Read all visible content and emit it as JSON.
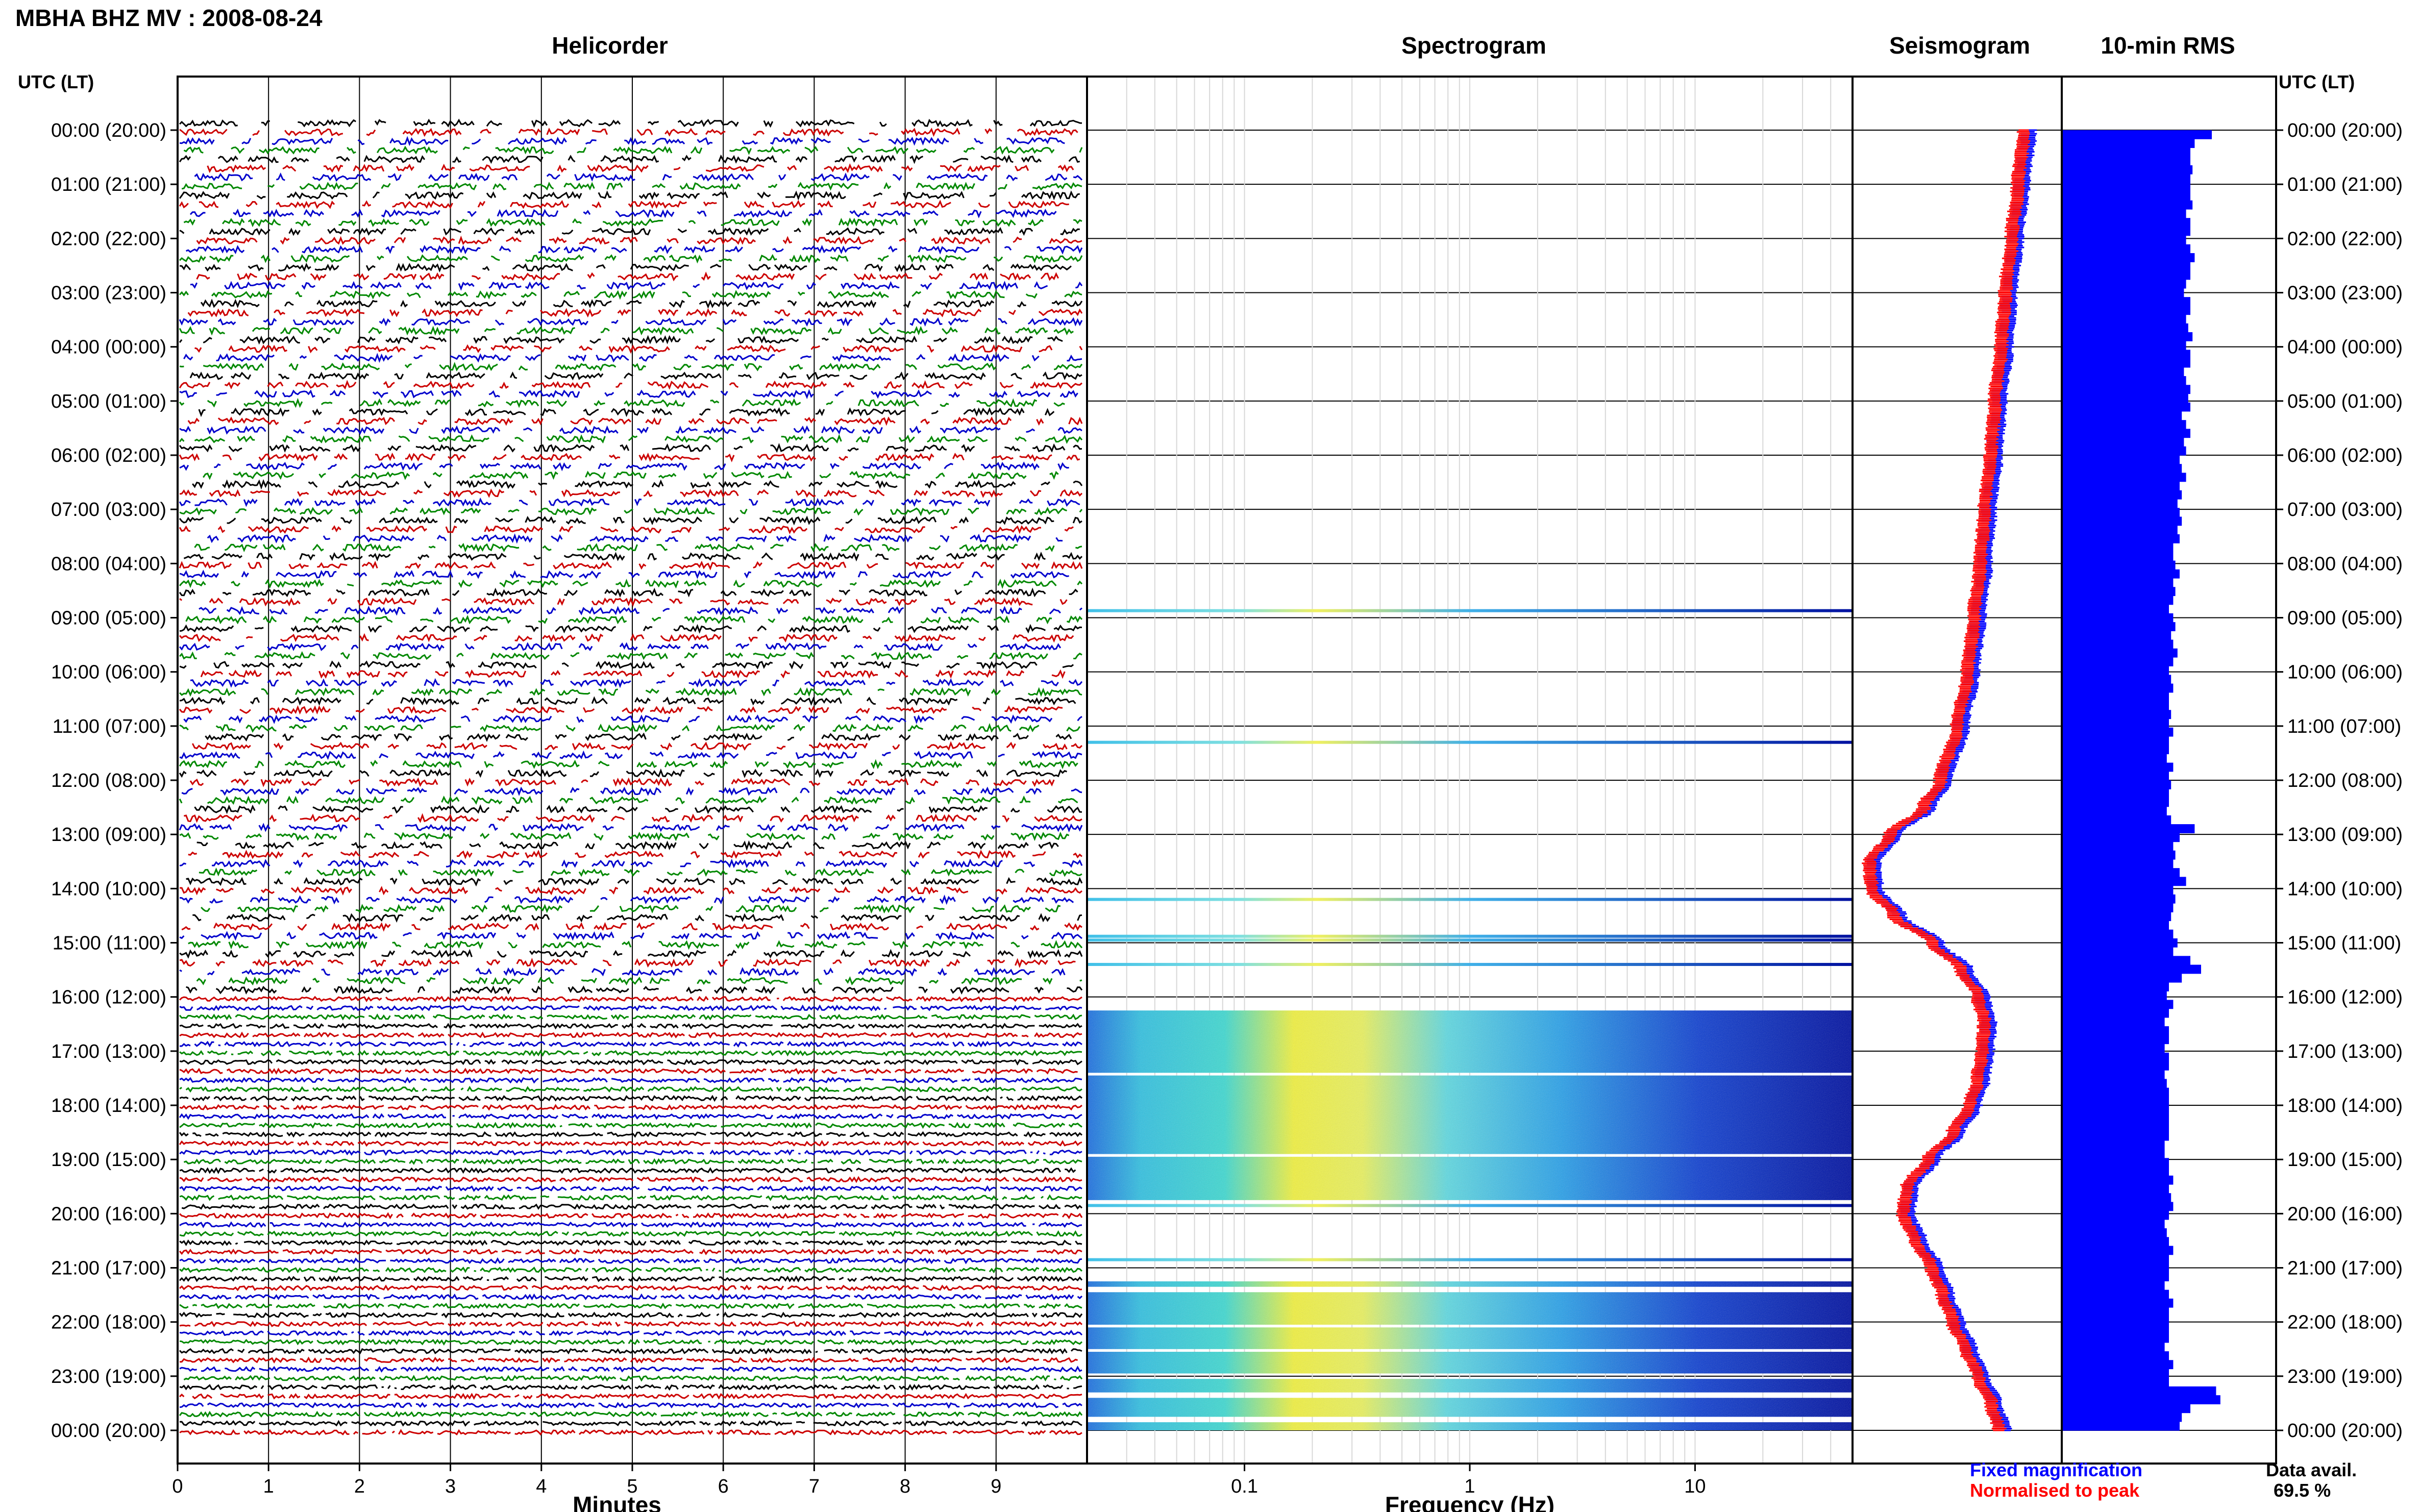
{
  "title": "MBHA BHZ MV : 2008-08-24",
  "panels": {
    "helicorder": "Helicorder",
    "spectrogram": "Spectrogram",
    "seismogram": "Seismogram",
    "rms": "10-min RMS"
  },
  "utc_header_left": "UTC (LT)",
  "utc_header_right": "UTC (LT)",
  "hour_labels": [
    "00:00 (20:00)",
    "01:00 (21:00)",
    "02:00 (22:00)",
    "03:00 (23:00)",
    "04:00 (00:00)",
    "05:00 (01:00)",
    "06:00 (02:00)",
    "07:00 (03:00)",
    "08:00 (04:00)",
    "09:00 (05:00)",
    "10:00 (06:00)",
    "11:00 (07:00)",
    "12:00 (08:00)",
    "13:00 (09:00)",
    "14:00 (10:00)",
    "15:00 (11:00)",
    "16:00 (12:00)",
    "17:00 (13:00)",
    "18:00 (14:00)",
    "19:00 (15:00)",
    "20:00 (16:00)",
    "21:00 (17:00)",
    "22:00 (18:00)",
    "23:00 (19:00)",
    "00:00 (20:00)"
  ],
  "legend": {
    "fixed": "Fixed magnification",
    "peak": "Normalised to peak",
    "data_avail_label": "Data avail.",
    "data_avail_value": "69.5 %"
  },
  "colors": {
    "trace": [
      "#000000",
      "#cc0000",
      "#0000cc",
      "#008800"
    ],
    "fixed": "#0000ff",
    "peak": "#ff0000",
    "rms": "#0000ff",
    "grid": "#000000"
  },
  "chart_data": [
    {
      "type": "line",
      "panel": "helicorder",
      "xlabel": "Minutes",
      "xlim": [
        0,
        10
      ],
      "xticks": [
        "0",
        "1",
        "2",
        "3",
        "4",
        "5",
        "6",
        "7",
        "8",
        "9"
      ],
      "y_hours": [
        0,
        24
      ],
      "traces_per_hour": 6,
      "continuous_from_hour": 16,
      "trace_colors": [
        "black",
        "red",
        "blue",
        "green"
      ]
    },
    {
      "type": "heatmap",
      "panel": "spectrogram",
      "xlabel": "Frequency (Hz)",
      "xscale": "log",
      "xlim": [
        0.02,
        50
      ],
      "xticks": [
        "0.1",
        "1",
        "10"
      ],
      "active_bands": [
        {
          "start": 16.25,
          "end": 17.4
        },
        {
          "start": 17.45,
          "end": 18.9
        },
        {
          "start": 18.95,
          "end": 19.75
        },
        {
          "start": 21.25,
          "end": 21.35
        },
        {
          "start": 21.45,
          "end": 22.05
        },
        {
          "start": 22.1,
          "end": 22.5
        },
        {
          "start": 22.55,
          "end": 22.95
        },
        {
          "start": 23.05,
          "end": 23.3
        },
        {
          "start": 23.4,
          "end": 23.75
        },
        {
          "start": 23.85,
          "end": 24.0
        }
      ],
      "thin_bands": [
        8.87,
        11.3,
        14.2,
        14.88,
        14.95,
        15.4,
        19.85,
        20.85
      ]
    },
    {
      "type": "line",
      "panel": "seismogram",
      "series": [
        {
          "name": "Fixed magnification",
          "hours": [
            0,
            1,
            2,
            3,
            4,
            5,
            6,
            7,
            8,
            9,
            10,
            11,
            12,
            12.5,
            13,
            13.5,
            14,
            14.5,
            15,
            15.5,
            16,
            16.5,
            17,
            17.5,
            18,
            18.5,
            19,
            19.5,
            20,
            20.5,
            21,
            21.5,
            22,
            22.5,
            23,
            23.5,
            24
          ],
          "values": [
            0.82,
            0.79,
            0.76,
            0.73,
            0.71,
            0.68,
            0.66,
            0.63,
            0.61,
            0.58,
            0.55,
            0.5,
            0.42,
            0.34,
            0.18,
            0.08,
            0.09,
            0.2,
            0.38,
            0.52,
            0.6,
            0.63,
            0.62,
            0.6,
            0.56,
            0.48,
            0.36,
            0.26,
            0.24,
            0.3,
            0.38,
            0.43,
            0.48,
            0.54,
            0.6,
            0.66,
            0.7
          ]
        },
        {
          "name": "Normalised to peak",
          "hours": [
            0,
            1,
            2,
            3,
            4,
            5,
            6,
            7,
            8,
            9,
            10,
            11,
            12,
            12.5,
            13,
            13.5,
            14,
            14.5,
            15,
            15.5,
            16,
            16.5,
            17,
            17.5,
            18,
            18.5,
            19,
            19.5,
            20,
            20.5,
            21,
            21.5,
            22,
            22.5,
            23,
            23.5,
            24
          ],
          "values": [
            0.82,
            0.79,
            0.76,
            0.73,
            0.71,
            0.68,
            0.66,
            0.63,
            0.61,
            0.58,
            0.55,
            0.5,
            0.42,
            0.34,
            0.18,
            0.08,
            0.09,
            0.2,
            0.38,
            0.52,
            0.6,
            0.63,
            0.62,
            0.6,
            0.56,
            0.48,
            0.36,
            0.26,
            0.24,
            0.3,
            0.38,
            0.43,
            0.48,
            0.54,
            0.6,
            0.66,
            0.7
          ]
        }
      ]
    },
    {
      "type": "bar",
      "panel": "rms",
      "interval_minutes": 10,
      "values": [
        0.7,
        0.62,
        0.6,
        0.6,
        0.61,
        0.6,
        0.6,
        0.6,
        0.61,
        0.58,
        0.6,
        0.6,
        0.58,
        0.6,
        0.62,
        0.6,
        0.6,
        0.58,
        0.57,
        0.6,
        0.6,
        0.58,
        0.59,
        0.61,
        0.58,
        0.6,
        0.6,
        0.57,
        0.58,
        0.6,
        0.59,
        0.6,
        0.56,
        0.58,
        0.6,
        0.57,
        0.58,
        0.55,
        0.56,
        0.58,
        0.55,
        0.56,
        0.54,
        0.55,
        0.56,
        0.54,
        0.55,
        0.52,
        0.52,
        0.53,
        0.55,
        0.52,
        0.53,
        0.52,
        0.5,
        0.52,
        0.53,
        0.51,
        0.52,
        0.54,
        0.52,
        0.5,
        0.51,
        0.52,
        0.5,
        0.5,
        0.51,
        0.5,
        0.52,
        0.5,
        0.5,
        0.49,
        0.52,
        0.5,
        0.51,
        0.5,
        0.5,
        0.49,
        0.51,
        0.62,
        0.55,
        0.52,
        0.53,
        0.52,
        0.55,
        0.58,
        0.52,
        0.53,
        0.52,
        0.51,
        0.5,
        0.52,
        0.54,
        0.52,
        0.6,
        0.65,
        0.56,
        0.5,
        0.49,
        0.52,
        0.5,
        0.48,
        0.5,
        0.5,
        0.48,
        0.5,
        0.5,
        0.48,
        0.49,
        0.5,
        0.5,
        0.5,
        0.5,
        0.5,
        0.5,
        0.48,
        0.48,
        0.5,
        0.5,
        0.52,
        0.5,
        0.51,
        0.52,
        0.5,
        0.48,
        0.49,
        0.5,
        0.52,
        0.5,
        0.5,
        0.5,
        0.48,
        0.5,
        0.52,
        0.5,
        0.5,
        0.5,
        0.5,
        0.48,
        0.5,
        0.52,
        0.5,
        0.5,
        0.72,
        0.74,
        0.6,
        0.56,
        0.55
      ]
    }
  ]
}
